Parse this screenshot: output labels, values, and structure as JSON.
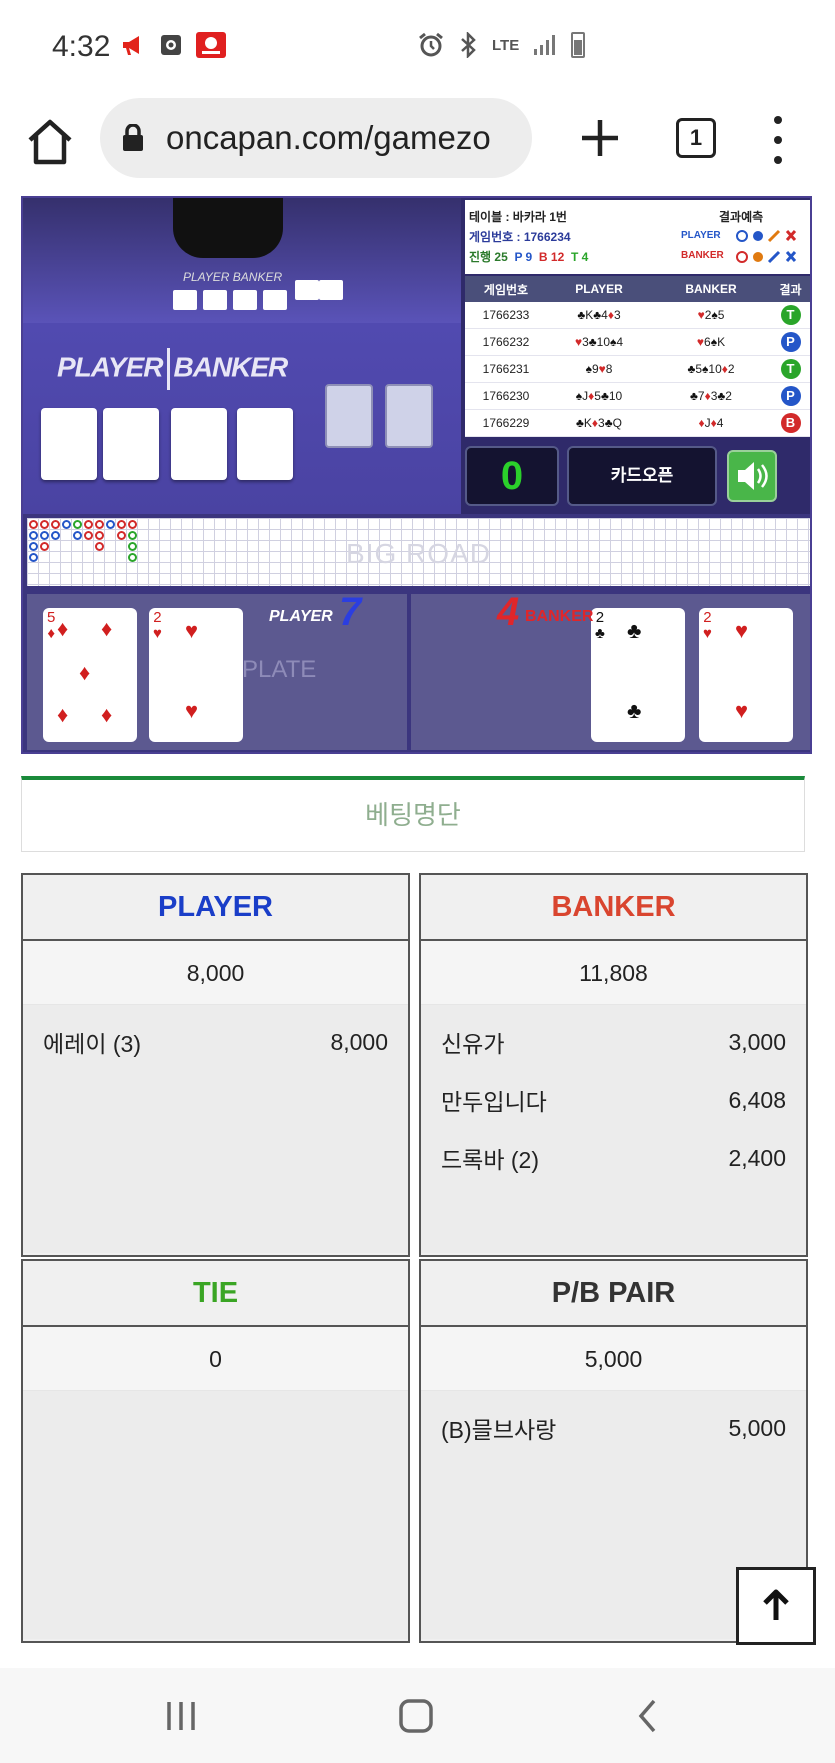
{
  "status_bar": {
    "time": "4:32",
    "network": "LTE"
  },
  "browser": {
    "url": "oncapan.com/gamezo",
    "tab_count": "1"
  },
  "game": {
    "video": {
      "player_banker_label_player": "PLAYER",
      "player_banker_label_banker": "BANKER",
      "small_label": "PLAYER  BANKER"
    },
    "info": {
      "table_label": "테이블 : 바카라 1번",
      "prediction_label": "결과예측",
      "game_number_label": "게임번호 : 1766234",
      "progress_label": "진행 25",
      "p_count": "P 9",
      "b_count": "B 12",
      "t_count": "T 4",
      "pred_player": "PLAYER",
      "pred_banker": "BANKER",
      "columns": [
        "게임번호",
        "PLAYER",
        "BANKER",
        "결과"
      ],
      "rows": [
        {
          "game": "1766233",
          "player": "♣K♣4♦3",
          "banker": "♥2♠5",
          "result": "T",
          "result_color": "#2aa52a"
        },
        {
          "game": "1766232",
          "player": "♥3♣10♠4",
          "banker": "♥6♠K",
          "result": "P",
          "result_color": "#2456c8"
        },
        {
          "game": "1766231",
          "player": "♠9♥8",
          "banker": "♣5♠10♦2",
          "result": "T",
          "result_color": "#2aa52a"
        },
        {
          "game": "1766230",
          "player": "♠J♦5♣10",
          "banker": "♣7♦3♣2",
          "result": "P",
          "result_color": "#2456c8"
        },
        {
          "game": "1766229",
          "player": "♣K♦3♣Q",
          "banker": "♦J♦4",
          "result": "B",
          "result_color": "#d22a2a"
        }
      ],
      "counter": "0",
      "card_open_button": "카드오픈"
    },
    "big_road_label": "BIG ROAD",
    "cards": {
      "player_label": "PLAYER",
      "player_score": "7",
      "banker_label": "BANKER",
      "banker_score": "4",
      "plate_label": "PLATE",
      "player_cards": [
        {
          "rank": "5",
          "suit": "♦",
          "color": "#d11f1f"
        },
        {
          "rank": "2",
          "suit": "♥",
          "color": "#d11f1f"
        }
      ],
      "banker_cards": [
        {
          "rank": "2",
          "suit": "♣",
          "color": "#111111"
        },
        {
          "rank": "2",
          "suit": "♥",
          "color": "#d11f1f"
        }
      ]
    }
  },
  "betting": {
    "title": "베팅명단",
    "player": {
      "label": "PLAYER",
      "color": "#1a3ec8",
      "total": "8,000",
      "entries": [
        {
          "name": "에레이 (3)",
          "amount": "8,000"
        }
      ]
    },
    "banker": {
      "label": "BANKER",
      "color": "#d9452f",
      "total": "11,808",
      "entries": [
        {
          "name": "신유가",
          "amount": "3,000"
        },
        {
          "name": "만두입니다",
          "amount": "6,408"
        },
        {
          "name": "드록바 (2)",
          "amount": "2,400"
        }
      ]
    },
    "tie": {
      "label": "TIE",
      "color": "#3aa524",
      "total": "0",
      "entries": []
    },
    "pair": {
      "label": "P/B PAIR",
      "color": "#333333",
      "total": "5,000",
      "entries": [
        {
          "name": "(B)믈브사랑",
          "amount": "5,000"
        }
      ]
    }
  },
  "icons": [
    "home-icon",
    "lock-icon",
    "plus-icon",
    "tabs-icon",
    "more-icon",
    "sound-icon",
    "arrow-up-icon",
    "recents-icon",
    "home-nav-icon",
    "back-icon"
  ]
}
